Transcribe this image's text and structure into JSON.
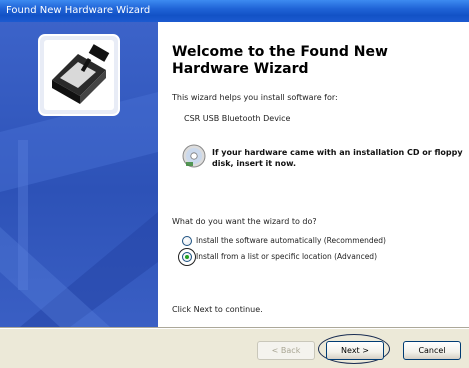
{
  "window": {
    "title": "Found New Hardware Wizard"
  },
  "sidebar": {
    "icon": "hardware-wizard-icon"
  },
  "main": {
    "heading": "Welcome to the Found New Hardware Wizard",
    "intro": "This wizard helps you install software for:",
    "device_name": "CSR USB Bluetooth Device",
    "cd_icon": "cd-icon",
    "cd_message": "If your hardware came with an installation CD or floppy disk, insert it now.",
    "question": "What do you want the wizard to do?",
    "options": [
      {
        "label": "Install the software automatically (Recommended)",
        "selected": false
      },
      {
        "label": "Install from a list or specific location (Advanced)",
        "selected": true
      }
    ],
    "continue_text": "Click Next to continue."
  },
  "buttons": {
    "back": "< Back",
    "next": "Next >",
    "cancel": "Cancel"
  },
  "colors": {
    "sidebar": "#2d52b7",
    "titlebar": "#1252c6",
    "face": "#ece9d8"
  }
}
